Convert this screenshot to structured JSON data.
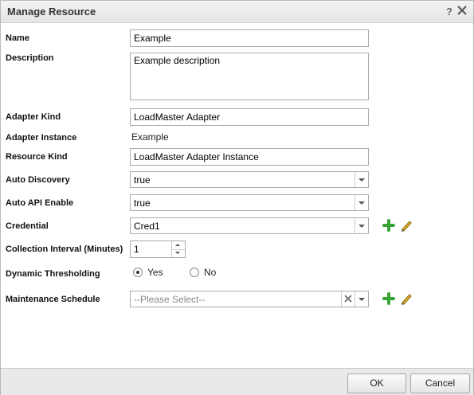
{
  "dialog": {
    "title": "Manage Resource",
    "help": "?"
  },
  "form": {
    "name": {
      "label": "Name",
      "value": "Example"
    },
    "description": {
      "label": "Description",
      "value": "Example description"
    },
    "adapter_kind": {
      "label": "Adapter Kind",
      "value": "LoadMaster Adapter"
    },
    "adapter_instance": {
      "label": "Adapter Instance",
      "value": "Example"
    },
    "resource_kind": {
      "label": "Resource Kind",
      "value": "LoadMaster Adapter Instance"
    },
    "auto_discovery": {
      "label": "Auto Discovery",
      "value": "true"
    },
    "auto_api_enable": {
      "label": "Auto API Enable",
      "value": "true"
    },
    "credential": {
      "label": "Credential",
      "value": "Cred1"
    },
    "collection_interval": {
      "label": "Collection Interval (Minutes)",
      "value": "1"
    },
    "dynamic_thresholding": {
      "label": "Dynamic Thresholding",
      "options": [
        "Yes",
        "No"
      ],
      "selected": "Yes"
    },
    "maintenance_schedule": {
      "label": "Maintenance Schedule",
      "placeholder": "--Please Select--"
    }
  },
  "footer": {
    "ok_label": "OK",
    "cancel_label": "Cancel"
  },
  "colors": {
    "add_icon": "#3aa335",
    "edit_icon": "#d1a21a"
  },
  "icons": [
    "help-icon",
    "close-icon",
    "dropdown-arrow-icon",
    "clear-icon",
    "add-icon",
    "edit-icon"
  ]
}
